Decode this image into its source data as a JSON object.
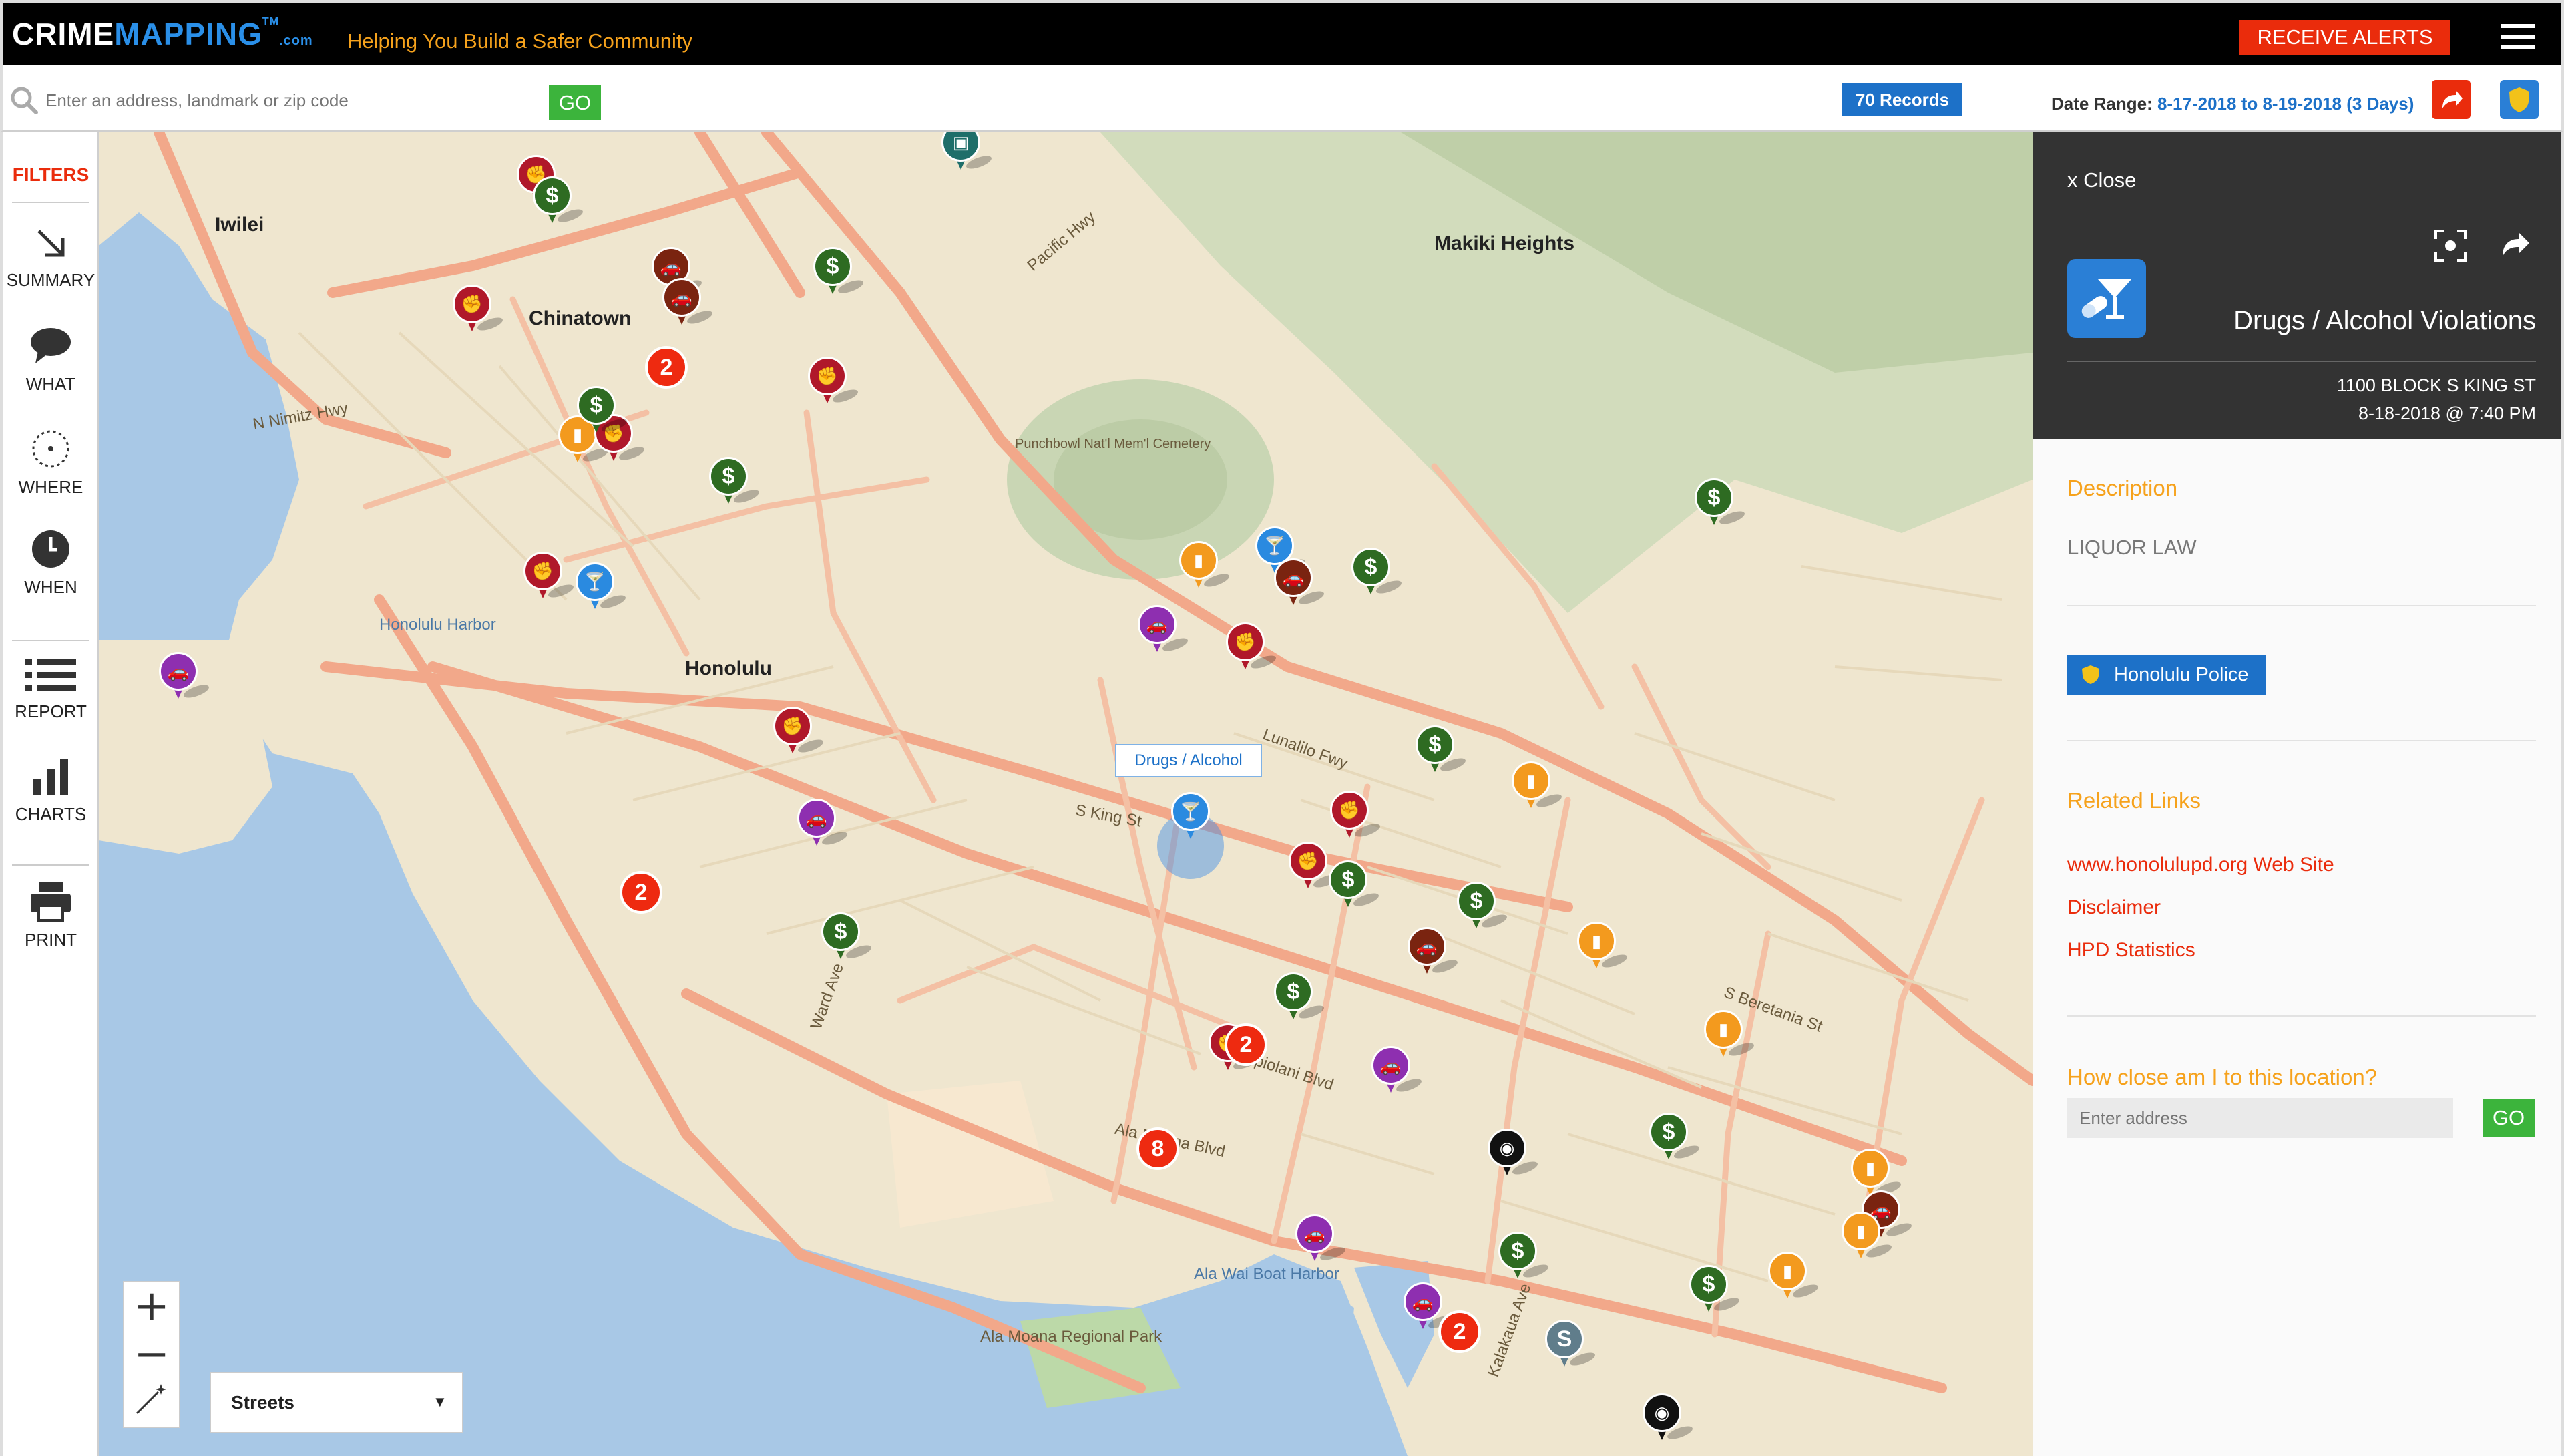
{
  "header": {
    "logo_main": "CRIME",
    "logo_accent": "MAPPING",
    "logo_tm": "TM",
    "logo_com": ".com",
    "tagline": "Helping You Build a Safer Community",
    "alerts_label": "RECEIVE ALERTS"
  },
  "search": {
    "placeholder": "Enter an address, landmark or zip code",
    "go_label": "GO",
    "records": "70 Records",
    "date_range_label": "Date Range:",
    "date_range_value": "8-17-2018 to 8-19-2018 (3 Days)"
  },
  "sidebar": {
    "filters_label": "FILTERS",
    "items": [
      {
        "label": "SUMMARY",
        "icon": "arrow-down-right-icon"
      },
      {
        "label": "WHAT",
        "icon": "speech-bubble-icon"
      },
      {
        "label": "WHERE",
        "icon": "target-icon"
      },
      {
        "label": "WHEN",
        "icon": "clock-icon"
      },
      {
        "label": "REPORT",
        "icon": "list-icon"
      },
      {
        "label": "CHARTS",
        "icon": "bar-chart-icon"
      },
      {
        "label": "PRINT",
        "icon": "printer-icon"
      }
    ]
  },
  "map": {
    "tooltip": "Drugs / Alcohol",
    "basemap_selected": "Streets",
    "zoom_in": "+",
    "zoom_out": "−",
    "labels": {
      "honolulu": "Honolulu",
      "chinatown": "Chinatown",
      "iwilei": "Iwilei",
      "makiki_heights": "Makiki Heights",
      "honolulu_harbor": "Honolulu Harbor",
      "ala_wai_boat_harbor": "Ala Wai Boat Harbor",
      "ala_moana_park": "Ala Moana Regional Park",
      "ala_moana_blvd": "Ala Moana Blvd",
      "king_st": "S King St",
      "lunalilo_fwy": "Lunalilo Fwy",
      "kapiolani_blvd": "Kapiolani Blvd",
      "beretania_st": "S Beretania St",
      "nimitz_hwy": "N Nimitz Hwy",
      "ward_ave": "Ward Ave",
      "kalakaua_ave": "Kalakaua Ave",
      "punchbowl": "Punchbowl Nat'l Mem'l Cemetery",
      "pacific_hwy": "Pacific Hwy"
    },
    "clusters": [
      "2",
      "2",
      "2",
      "8",
      "2"
    ],
    "colors": {
      "theft": "#2e6b22",
      "assault": "#b0182a",
      "vehicle": "#7a2410",
      "drugs": "#2a8ae0",
      "dui": "#f39a1e",
      "vandalism": "#8e2fb0",
      "burglary": "#111111",
      "sex": "#607d8b",
      "cluster": "#ee2a10",
      "bus": "#1e6e6a"
    }
  },
  "panel": {
    "close_label": "x Close",
    "category_title": "Drugs / Alcohol Violations",
    "address": "1100 BLOCK S KING ST",
    "datetime": "8-18-2018 @ 7:40 PM",
    "description_title": "Description",
    "description": "LIQUOR LAW",
    "agency": "Honolulu Police",
    "related_title": "Related Links",
    "links": [
      "www.honolulupd.org Web Site",
      "Disclaimer",
      "HPD Statistics"
    ],
    "nearby_title": "How close am I to this location?",
    "nearby_placeholder": "Enter address",
    "nearby_go": "GO"
  }
}
